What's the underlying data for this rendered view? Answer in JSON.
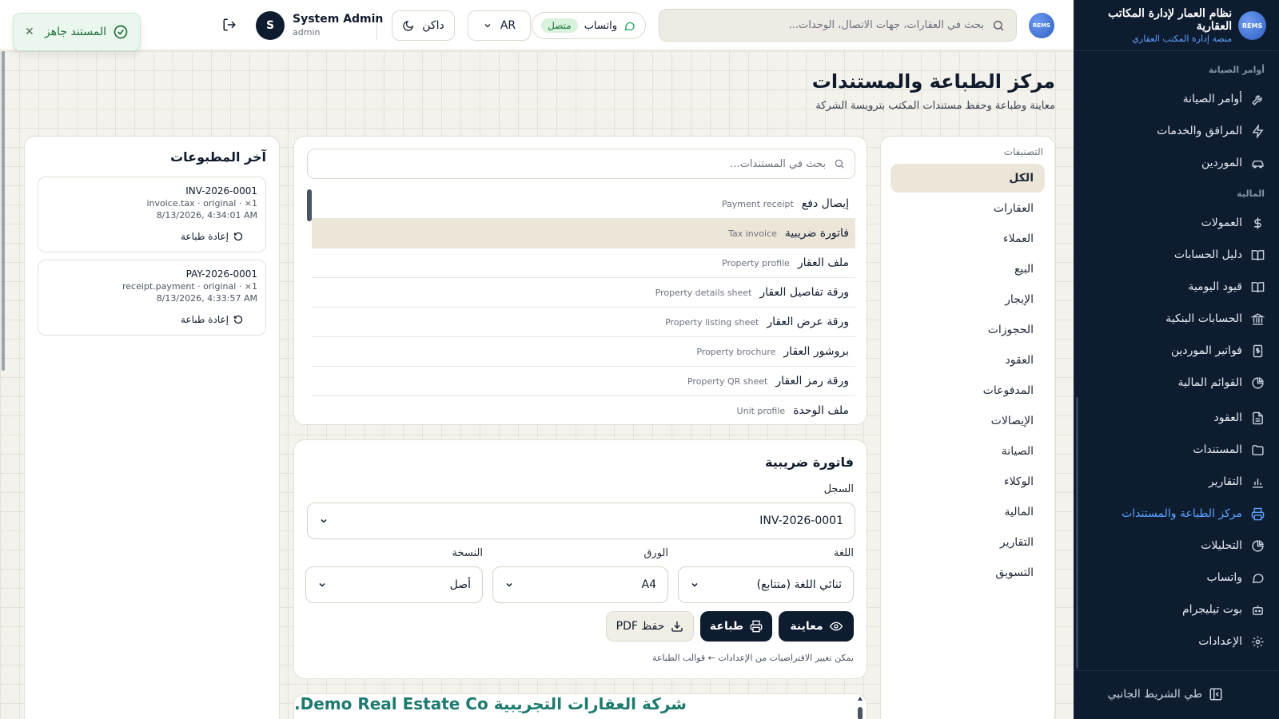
{
  "brand": {
    "logo_text": "REMS",
    "name": "نظام العمار لإدارة المكاتب العقارية",
    "subtitle": "منصة إدارة المكتب العقاري"
  },
  "sidebar": {
    "sections": [
      {
        "label": "أوامر الصيانة"
      },
      {
        "label": "المالية"
      }
    ],
    "items": [
      {
        "label": "أوامر الصيانة",
        "icon": "wrench-icon"
      },
      {
        "label": "المرافق والخدمات",
        "icon": "bolt-icon"
      },
      {
        "label": "الموردين",
        "icon": "truck-icon"
      },
      {
        "label": "العمولات",
        "icon": "dollar-icon"
      },
      {
        "label": "دليل الحسابات",
        "icon": "book-icon"
      },
      {
        "label": "قيود اليومية",
        "icon": "journal-icon"
      },
      {
        "label": "الحسابات البنكية",
        "icon": "bank-icon"
      },
      {
        "label": "فواتير الموردين",
        "icon": "invoice-icon"
      },
      {
        "label": "القوائم المالية",
        "icon": "pie-icon"
      },
      {
        "label": "العقود",
        "icon": "file-icon"
      },
      {
        "label": "المستندات",
        "icon": "folder-icon"
      },
      {
        "label": "التقارير",
        "icon": "bar-chart-icon"
      },
      {
        "label": "مركز الطباعة والمستندات",
        "icon": "printer-icon",
        "active": true
      },
      {
        "label": "التحليلات",
        "icon": "pie-icon"
      },
      {
        "label": "واتساب",
        "icon": "chat-icon"
      },
      {
        "label": "بوت تيليجرام",
        "icon": "bot-icon"
      },
      {
        "label": "الإعدادات",
        "icon": "gear-icon"
      }
    ],
    "collapse_label": "طي الشريط الجانبي"
  },
  "header": {
    "search_placeholder": "بحث في العقارات، جهات الاتصال، الوحدات...",
    "whatsapp_label": "واتساب",
    "whatsapp_status": "متصل",
    "language": "AR",
    "theme_label": "داكن",
    "user_initial": "S",
    "user_name": "System Admin",
    "user_role": "admin"
  },
  "toast": {
    "message": "المستند جاهز"
  },
  "page": {
    "title": "مركز الطباعة والمستندات",
    "subtitle": "معاينة وطباعة وحفظ مستندات المكتب بترويسة الشركة"
  },
  "categories": {
    "title": "التصنيفات",
    "items": [
      "الكل",
      "العقارات",
      "العملاء",
      "البيع",
      "الإيجار",
      "الحجوزات",
      "العقود",
      "المدفوعات",
      "الإيصالات",
      "الصيانة",
      "الوكلاء",
      "المالية",
      "التقارير",
      "التسويق"
    ]
  },
  "documents": {
    "search_placeholder": "بحث في المستندات...",
    "items": [
      {
        "ar": "إيصال دفع",
        "en": "Payment receipt"
      },
      {
        "ar": "فاتورة ضريبية",
        "en": "Tax invoice",
        "selected": true
      },
      {
        "ar": "ملف العقار",
        "en": "Property profile"
      },
      {
        "ar": "ورقة تفاصيل العقار",
        "en": "Property details sheet"
      },
      {
        "ar": "ورقة عرض العقار",
        "en": "Property listing sheet"
      },
      {
        "ar": "بروشور العقار",
        "en": "Property brochure"
      },
      {
        "ar": "ورقة رمز العقار",
        "en": "Property QR sheet"
      },
      {
        "ar": "ملف الوحدة",
        "en": "Unit profile"
      }
    ]
  },
  "form": {
    "title": "فاتورة ضريبية",
    "record_label": "السجل",
    "record_value": "INV-2026-0001",
    "language_label": "اللغة",
    "language_value": "ثنائي اللغة (متتابع)",
    "paper_label": "الورق",
    "paper_value": "A4",
    "copy_label": "النسخة",
    "copy_value": "أصل",
    "preview_button": "معاينة",
    "print_button": "طباعة",
    "pdf_button": "حفظ PDF",
    "hint": "يمكن تغيير الافتراضيات من الإعدادات ← قوالب الطباعة"
  },
  "preview": {
    "company_header": "شركة العقارات التجريبية Demo Real Estate Co."
  },
  "recent": {
    "title": "آخر المطبوعات",
    "reprint_label": "إعادة طباعة",
    "items": [
      {
        "number": "INV-2026-0001",
        "meta": "invoice.tax · original · ×1",
        "time": "8/13/2026, 4:34:01 AM"
      },
      {
        "number": "PAY-2026-0001",
        "meta": "receipt.payment · original · ×1",
        "time": "8/13/2026, 4:33:57 AM"
      }
    ]
  },
  "colors": {
    "sidebar_bg": "#0e1c30",
    "accent": "#5aa2ff",
    "selected_bg": "#ece6d8",
    "preview_header": "#1d7a6e",
    "success": "#1f7a3a"
  }
}
